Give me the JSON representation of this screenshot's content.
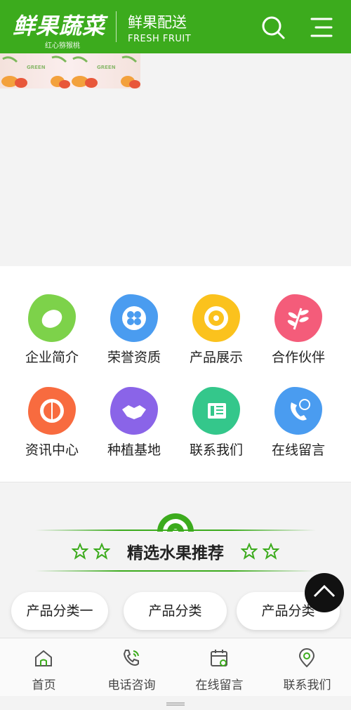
{
  "header": {
    "logo_text": "鲜果蔬菜",
    "logo_sub": "红心猕猴桃",
    "tagline": "鲜果配送",
    "tagline_en": "FRESH FRUIT",
    "background": "#3cab1d"
  },
  "banner": {
    "tile_text": "GREEN"
  },
  "grid": {
    "items": [
      {
        "label": "企业简介",
        "icon": "lemon-icon",
        "color": "#7dd24a"
      },
      {
        "label": "荣誉资质",
        "icon": "clover-icon",
        "color": "#4a9cf0"
      },
      {
        "label": "产品展示",
        "icon": "kiwi-icon",
        "color": "#fbc21d"
      },
      {
        "label": "合作伙伴",
        "icon": "leaf-icon",
        "color": "#f45c7a"
      },
      {
        "label": "资讯中心",
        "icon": "melon-icon",
        "color": "#f86b3f"
      },
      {
        "label": "种植基地",
        "icon": "handshake-icon",
        "color": "#8a64e8"
      },
      {
        "label": "联系我们",
        "icon": "document-icon",
        "color": "#34c78b"
      },
      {
        "label": "在线留言",
        "icon": "phone-24-icon",
        "color": "#4a9cf0"
      }
    ]
  },
  "section": {
    "title": "精选水果推荐",
    "accent": "#3cab1d"
  },
  "categories": [
    "产品分类一",
    "产品分类",
    "产品分类"
  ],
  "bottom_nav": [
    {
      "label": "首页",
      "icon": "home-icon"
    },
    {
      "label": "电话咨询",
      "icon": "phone-icon"
    },
    {
      "label": "在线留言",
      "icon": "calendar-icon"
    },
    {
      "label": "联系我们",
      "icon": "location-icon"
    }
  ]
}
